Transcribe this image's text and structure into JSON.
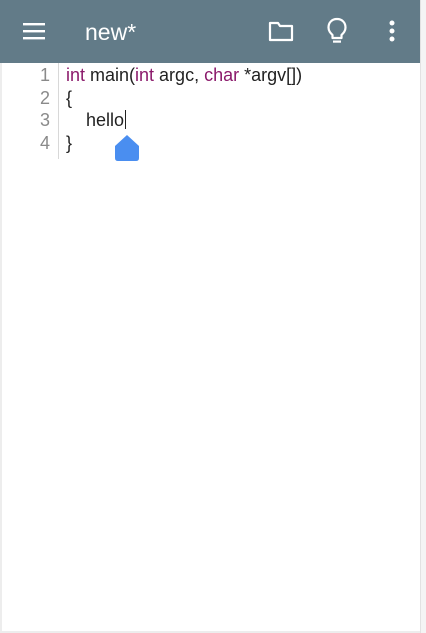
{
  "toolbar": {
    "title": "new*",
    "icons": {
      "menu": "menu-icon",
      "folder": "folder-icon",
      "bulb": "lightbulb-icon",
      "more": "more-vert-icon"
    },
    "color": "#627b88"
  },
  "editor": {
    "lines": [
      {
        "number": "1",
        "tokens": [
          {
            "text": "int",
            "type": "keyword"
          },
          {
            "text": " main(",
            "type": "plain"
          },
          {
            "text": "int",
            "type": "keyword"
          },
          {
            "text": " argc, ",
            "type": "plain"
          },
          {
            "text": "char",
            "type": "keyword"
          },
          {
            "text": " *argv[])",
            "type": "plain"
          }
        ]
      },
      {
        "number": "2",
        "tokens": [
          {
            "text": "{",
            "type": "plain"
          }
        ]
      },
      {
        "number": "3",
        "tokens": [
          {
            "text": "    hello",
            "type": "plain"
          }
        ]
      },
      {
        "number": "4",
        "tokens": [
          {
            "text": "}",
            "type": "plain"
          }
        ]
      }
    ],
    "keyword_color": "#8b1a6b",
    "caret_handle_color": "#4a8ef0"
  }
}
